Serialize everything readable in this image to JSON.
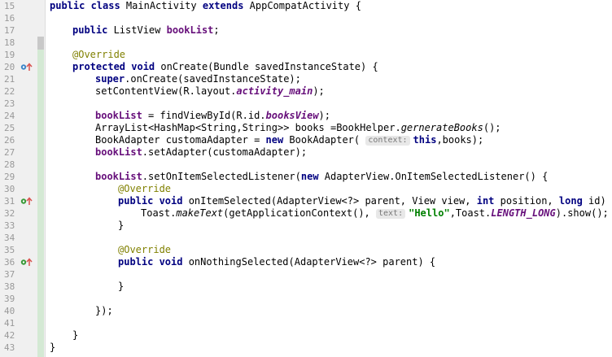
{
  "gutter": {
    "line_numbers": [
      "15",
      "16",
      "17",
      "18",
      "19",
      "20",
      "21",
      "22",
      "23",
      "24",
      "25",
      "26",
      "27",
      "28",
      "29",
      "30",
      "31",
      "32",
      "33",
      "34",
      "35",
      "36",
      "37",
      "38",
      "39",
      "40",
      "41",
      "42",
      "43"
    ],
    "override_marker_lines": [
      "20",
      "31",
      "36"
    ]
  },
  "colors": {
    "keyword": "#000080",
    "annotation": "#808000",
    "field": "#660e7a",
    "string": "#008000",
    "hint_background": "#e8e8e8",
    "gutter_background": "#f0f0f0",
    "change_marker": "#d4e9d4"
  },
  "code": {
    "l15": {
      "kw1": "public class",
      "t1": " MainActivity ",
      "kw2": "extends",
      "t2": " AppCompatActivity {"
    },
    "l17": {
      "kw1": "public",
      "t1": " ListView ",
      "f1": "bookList",
      "t2": ";"
    },
    "l19": {
      "ann1": "@Override"
    },
    "l20": {
      "kw1": "protected void",
      "t1": " onCreate(Bundle savedInstanceState) {"
    },
    "l21": {
      "kw1": "super",
      "t1": ".onCreate(savedInstanceState);"
    },
    "l22": {
      "t1": "setContentView(R.layout.",
      "if1": "activity_main",
      "t2": ");"
    },
    "l24": {
      "f1": "bookList",
      "t1": " = findViewById(R.id.",
      "if1": "booksView",
      "t2": ");"
    },
    "l25": {
      "t1": "ArrayList<HashMap<String,String>> books =BookHelper.",
      "it1": "gernerateBooks",
      "t2": "();"
    },
    "l26": {
      "t1": "BookAdapter customaAdapter = ",
      "kw1": "new",
      "t2": " BookAdapter( ",
      "h1": "context:",
      "kw2": "this",
      "t3": ",books);"
    },
    "l27": {
      "f1": "bookList",
      "t1": ".setAdapter(customaAdapter);"
    },
    "l29": {
      "f1": "bookList",
      "t1": ".setOnItemSelectedListener(",
      "kw1": "new",
      "t2": " AdapterView.OnItemSelectedListener() {"
    },
    "l30": {
      "ann1": "@Override"
    },
    "l31": {
      "kw1": "public void",
      "t1": " onItemSelected(AdapterView<?> parent, View view, ",
      "kw2": "int",
      "t2": " position, ",
      "kw3": "long",
      "t3": " id) {"
    },
    "l32": {
      "t1": "Toast.",
      "it1": "makeText",
      "t2": "(getApplicationContext(), ",
      "h1": "text:",
      "s1": "\"Hello\"",
      "t3": ",Toast.",
      "if1": "LENGTH_LONG",
      "t4": ").show();"
    },
    "l33": {
      "t1": "}"
    },
    "l35": {
      "ann1": "@Override"
    },
    "l36": {
      "kw1": "public void",
      "t1": " onNothingSelected(AdapterView<?> parent) {"
    },
    "l38": {
      "t1": "}"
    },
    "l40": {
      "t1": "});"
    },
    "l42": {
      "t1": "}"
    },
    "l43": {
      "t1": "}"
    }
  }
}
